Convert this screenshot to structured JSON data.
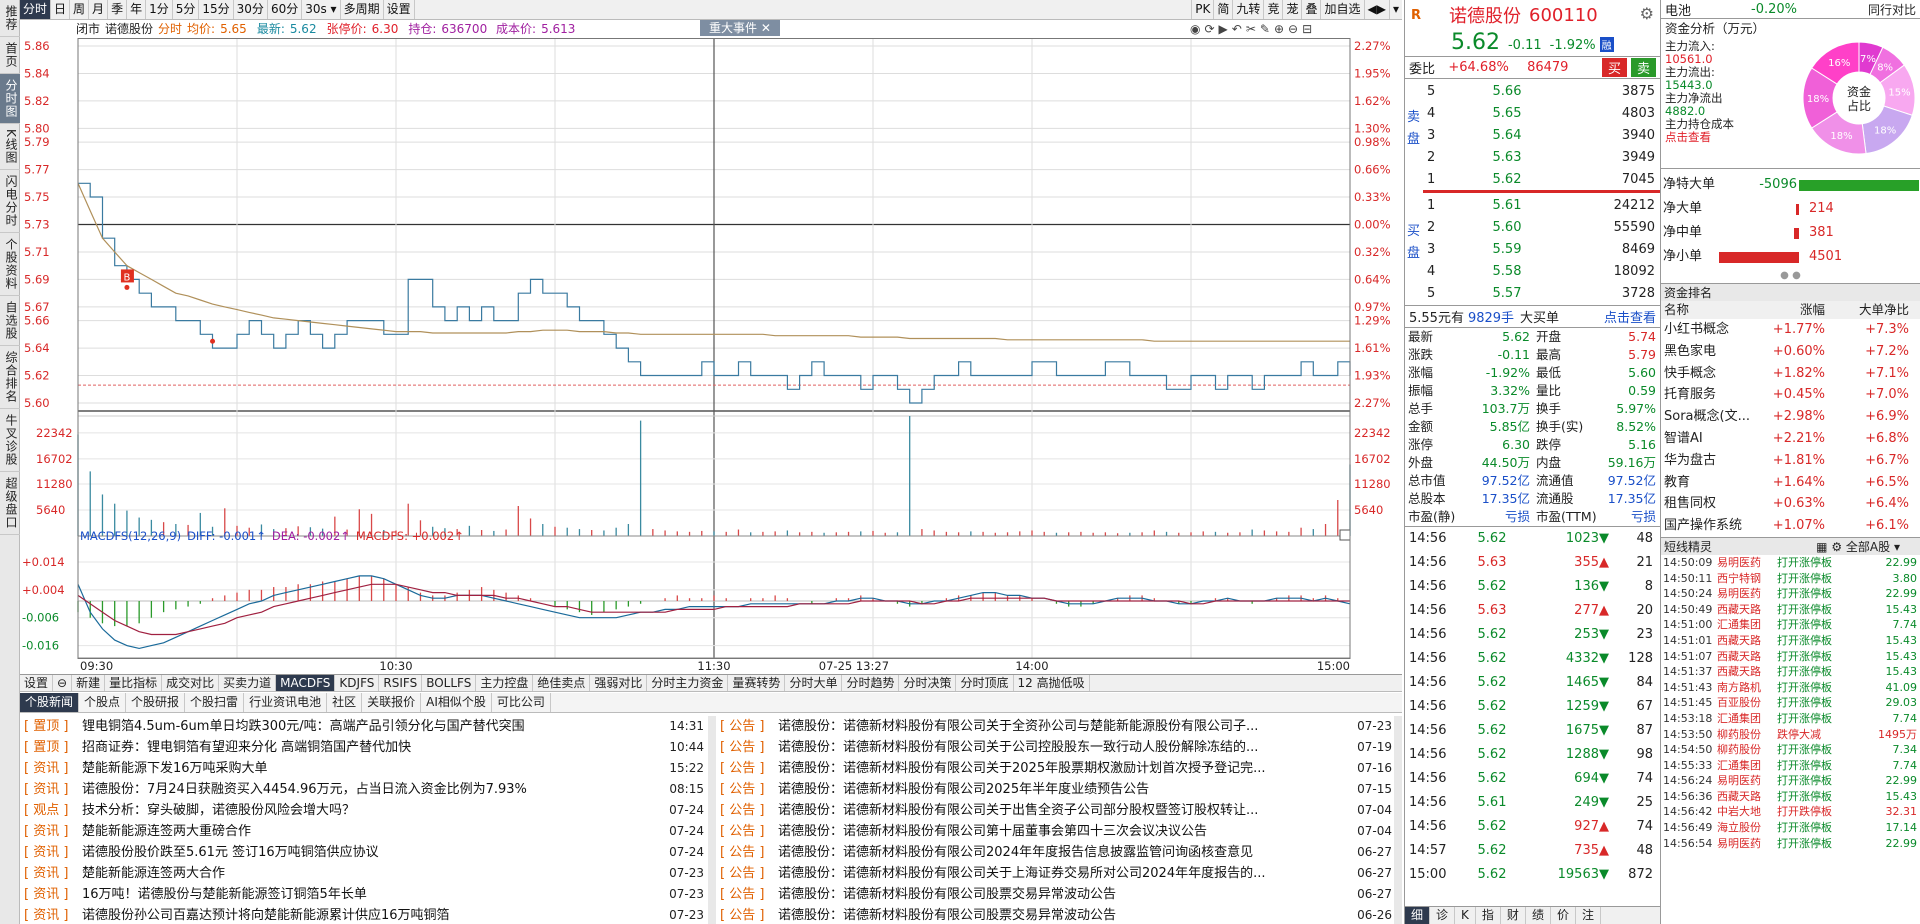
{
  "sidebar": [
    "推荐",
    "首页",
    "分时图",
    "K线图",
    "闪电分时",
    "个股资料",
    "自选股",
    "综合排名",
    "牛叉诊股",
    "超级盘口"
  ],
  "toolbar": {
    "left": [
      "分时",
      "日",
      "周",
      "月",
      "季",
      "年",
      "1分",
      "5分",
      "15分",
      "30分",
      "60分",
      "30s ▾",
      "多周期",
      "设置"
    ],
    "right": [
      "PK",
      "简",
      "九转",
      "竞",
      "茏",
      "叠",
      "加自选",
      "◀▶",
      "▾"
    ]
  },
  "head": {
    "market": "闭市",
    "name": "诺德股份",
    "mode": "分时",
    "avg_label": "均价:",
    "avg": "5.65",
    "last_label": "最新:",
    "last": "5.62",
    "limit_label": "张停价:",
    "limit": "6.30",
    "hold_label": "持仓:",
    "hold": "636700",
    "cost_label": "成本价:",
    "cost": "5.613",
    "event": "重大事件"
  },
  "axis": {
    "left": [
      "5.86",
      "5.84",
      "5.82",
      "5.80",
      "5.79",
      "5.77",
      "5.75",
      "5.73",
      "5.71",
      "5.69",
      "5.67",
      "5.66",
      "5.64",
      "5.62",
      "5.60"
    ],
    "right": [
      "2.27%",
      "1.95%",
      "1.62%",
      "1.30%",
      "0.98%",
      "0.66%",
      "0.33%",
      "0.00%",
      "0.32%",
      "0.64%",
      "0.97%",
      "1.29%",
      "1.61%",
      "1.93%",
      "2.27%"
    ],
    "vol": [
      "22342",
      "16702",
      "11280",
      "5640"
    ],
    "macd": [
      "+0.014",
      "+0.004",
      "-0.006",
      "-0.016"
    ],
    "time": [
      "09:30",
      "10:30",
      "11:30",
      "07-25 13:27",
      "14:00",
      "15:00"
    ]
  },
  "macd_head": {
    "name": "MACDFS(12,26,9)",
    "diff": "DIFF: -0.001↑",
    "dea": "DEA: -0.002↑",
    "macd": "MACDFS: +0.002↑"
  },
  "markers": {
    "b": "B"
  },
  "indicator_tabs": [
    "设置",
    "⊖",
    "新建",
    "量比指标",
    "成交对比",
    "买卖力道",
    "MACDFS",
    "KDJFS",
    "RSIFS",
    "BOLLFS",
    "主力控盘",
    "绝佳卖点",
    "强弱对比",
    "分时主力资金",
    "量赛转势",
    "分时大单",
    "分时趋势",
    "分时决策",
    "分时顶底",
    "12 高抛低吸"
  ],
  "news_tabs": [
    "个股新闻",
    "个股点",
    "个股研报",
    "个股扫雷",
    "行业资讯电池",
    "社区",
    "关联报价",
    "AI相似个股",
    "可比公司"
  ],
  "news_left": [
    {
      "cat": "[ 置顶 ]",
      "title": "锂电铜箔4.5um-6um单日均跌300元/吨：高端产品引领分化与国产替代突围",
      "date": "14:31"
    },
    {
      "cat": "[ 置顶 ]",
      "title": "招商证券：锂电铜箔有望迎来分化 高端铜箔国产替代加快",
      "date": "10:44"
    },
    {
      "cat": "[ 资讯 ]",
      "title": "楚能新能源下发16万吨采购大单",
      "date": "15:22"
    },
    {
      "cat": "[ 资讯 ]",
      "title": "诺德股份：7月24日获融资买入4454.96万元，占当日流入资金比例为7.93%",
      "date": "08:15"
    },
    {
      "cat": "[ 观点 ]",
      "title": "技术分析：穿头破脚，诺德股份风险会增大吗？",
      "date": "07-24"
    },
    {
      "cat": "[ 资讯 ]",
      "title": "楚能新能源连签两大重磅合作",
      "date": "07-24"
    },
    {
      "cat": "[ 资讯 ]",
      "title": "诺德股份股价跌至5.61元 签订16万吨铜箔供应协议",
      "date": "07-24"
    },
    {
      "cat": "[ 资讯 ]",
      "title": "楚能新能源连签两大合作",
      "date": "07-23"
    },
    {
      "cat": "[ 资讯 ]",
      "title": "16万吨！诺德股份与楚能新能源签订铜箔5年长单",
      "date": "07-23"
    },
    {
      "cat": "[ 资讯 ]",
      "title": "诺德股份孙公司百嘉达预计将向楚能新能源累计供应16万吨铜箔",
      "date": "07-23"
    }
  ],
  "news_right": [
    {
      "cat": "[ 公告 ]",
      "title": "诺德股份：诺德新材料股份有限公司关于全资孙公司与楚能新能源股份有限公司子...",
      "date": "07-23"
    },
    {
      "cat": "[ 公告 ]",
      "title": "诺德股份：诺德新材料股份有限公司关于公司控股股东一致行动人股份解除冻结的...",
      "date": "07-19"
    },
    {
      "cat": "[ 公告 ]",
      "title": "诺德股份：诺德新材料股份有限公司关于2025年股票期权激励计划首次授予登记完...",
      "date": "07-16"
    },
    {
      "cat": "[ 公告 ]",
      "title": "诺德股份：诺德新材料股份有限公司2025年半年度业绩预告公告",
      "date": "07-15"
    },
    {
      "cat": "[ 公告 ]",
      "title": "诺德股份：诺德新材料股份有限公司关于出售全资子公司部分股权暨签订股权转让...",
      "date": "07-04"
    },
    {
      "cat": "[ 公告 ]",
      "title": "诺德股份：诺德新材料股份有限公司第十届董事会第四十三次会议决议公告",
      "date": "07-04"
    },
    {
      "cat": "[ 公告 ]",
      "title": "诺德股份：诺德新材料股份有限公司2024年年度报告信息披露监管问询函核查意见",
      "date": "06-27"
    },
    {
      "cat": "[ 公告 ]",
      "title": "诺德股份：诺德新材料股份有限公司关于上海证券交易所对公司2024年年度报告的...",
      "date": "06-27"
    },
    {
      "cat": "[ 公告 ]",
      "title": "诺德股份：诺德新材料股份有限公司股票交易异常波动公告",
      "date": "06-27"
    },
    {
      "cat": "[ 公告 ]",
      "title": "诺德股份：诺德新材料股份有限公司股票交易异常波动公告",
      "date": "06-26"
    }
  ],
  "quote": {
    "logo": "R",
    "name": "诺德股份",
    "code": "600110",
    "price": "5.62",
    "change": "-0.11",
    "pct": "-1.92%",
    "tag": "融",
    "wb_label": "委比",
    "wb": "+64.68%",
    "wc": "86479",
    "buy": "买",
    "sell": "卖",
    "asks": [
      {
        "n": "5",
        "p": "5.66",
        "v": "3875"
      },
      {
        "n": "4",
        "p": "5.65",
        "v": "4803"
      },
      {
        "n": "3",
        "p": "5.64",
        "v": "3940"
      },
      {
        "n": "2",
        "p": "5.63",
        "v": "3949"
      },
      {
        "n": "1",
        "p": "5.62",
        "v": "7045"
      }
    ],
    "bids": [
      {
        "n": "1",
        "p": "5.61",
        "v": "24212"
      },
      {
        "n": "2",
        "p": "5.60",
        "v": "55590"
      },
      {
        "n": "3",
        "p": "5.59",
        "v": "8469"
      },
      {
        "n": "4",
        "p": "5.58",
        "v": "18092"
      },
      {
        "n": "5",
        "p": "5.57",
        "v": "3728"
      }
    ],
    "ask_label": "卖盘",
    "bid_label": "买盘",
    "big": {
      "price": "5.55元有",
      "qty": "9829手",
      "label": "大买单",
      "link": "点击查看"
    },
    "stats": [
      [
        "最新",
        "5.62",
        "开盘",
        "5.74"
      ],
      [
        "涨跌",
        "-0.11",
        "最高",
        "5.79"
      ],
      [
        "涨幅",
        "-1.92%",
        "最低",
        "5.60"
      ],
      [
        "振幅",
        "3.32%",
        "量比",
        "0.59"
      ],
      [
        "总手",
        "103.7万",
        "换手",
        "5.97%"
      ],
      [
        "金额",
        "5.85亿",
        "换手(实)",
        "8.52%"
      ],
      [
        "涨停",
        "6.30",
        "跌停",
        "5.16"
      ],
      [
        "外盘",
        "44.50万",
        "内盘",
        "59.16万"
      ],
      [
        "总市值",
        "97.52亿",
        "流通值",
        "97.52亿"
      ],
      [
        "总股本",
        "17.35亿",
        "流通股",
        "17.35亿"
      ],
      [
        "市盈(静)",
        "亏损",
        "市盈(TTM)",
        "亏损"
      ]
    ],
    "trades": [
      [
        "14:56",
        "5.62",
        "1023",
        "48",
        "d"
      ],
      [
        "14:56",
        "5.63",
        "355",
        "21",
        "u"
      ],
      [
        "14:56",
        "5.62",
        "136",
        "8",
        "d"
      ],
      [
        "14:56",
        "5.63",
        "277",
        "20",
        "u"
      ],
      [
        "14:56",
        "5.62",
        "253",
        "23",
        "d"
      ],
      [
        "14:56",
        "5.62",
        "4332",
        "128",
        "d"
      ],
      [
        "14:56",
        "5.62",
        "1465",
        "84",
        "d"
      ],
      [
        "14:56",
        "5.62",
        "1259",
        "67",
        "d"
      ],
      [
        "14:56",
        "5.62",
        "1675",
        "87",
        "d"
      ],
      [
        "14:56",
        "5.62",
        "1288",
        "98",
        "d"
      ],
      [
        "14:56",
        "5.62",
        "694",
        "74",
        "d"
      ],
      [
        "14:56",
        "5.61",
        "249",
        "25",
        "d"
      ],
      [
        "14:56",
        "5.62",
        "927",
        "74",
        "u"
      ],
      [
        "14:57",
        "5.62",
        "735",
        "48",
        "u"
      ],
      [
        "15:00",
        "5.62",
        "19563",
        "872",
        "d"
      ]
    ],
    "bottom_tabs": [
      "细",
      "诊",
      "K",
      "指",
      "财",
      "绩",
      "价",
      "注"
    ]
  },
  "fund": {
    "top_name": "电池",
    "top_pct": "-0.20%",
    "top_right": "同行对比",
    "title": "资金分析（万元）",
    "inflow_label": "主力流入:",
    "inflow": "10561.0",
    "outflow_label": "主力流出:",
    "outflow": "15443.0",
    "net_label": "主力净流出",
    "net": "4882.0",
    "cost_label": "主力持仓成本",
    "cost_link": "点击查看",
    "donut_center": "资金占比",
    "donut": [
      {
        "label": "7%",
        "v": 7,
        "c": "#e03ad0"
      },
      {
        "label": "8%",
        "v": 8,
        "c": "#f070e0"
      },
      {
        "label": "15%",
        "v": 15,
        "c": "#f8a8f0"
      },
      {
        "label": "18%",
        "v": 18,
        "c": "#c8a8f0"
      },
      {
        "label": "18%",
        "v": 18,
        "c": "#f090e8"
      },
      {
        "label": "18%",
        "v": 18,
        "c": "#f060d8"
      },
      {
        "label": "16%",
        "v": 16,
        "c": "#ff40c8"
      }
    ],
    "flows": [
      {
        "label": "净特大单",
        "value": "-5096",
        "w": 170,
        "c": "#28a028"
      },
      {
        "label": "净大单",
        "value": "214",
        "w": 3,
        "c": "#d82828"
      },
      {
        "label": "净中单",
        "value": "381",
        "w": 5,
        "c": "#d82828"
      },
      {
        "label": "净小单",
        "value": "4501",
        "w": 80,
        "c": "#d82828"
      }
    ],
    "rank_title": "资金排名",
    "rank_cols": [
      "名称",
      "涨幅",
      "大单净比"
    ],
    "rank": [
      [
        "小红书概念",
        "+1.77%",
        "+7.3%"
      ],
      [
        "黑色家电",
        "+0.60%",
        "+7.2%"
      ],
      [
        "快手概念",
        "+1.82%",
        "+7.1%"
      ],
      [
        "托育服务",
        "+0.45%",
        "+7.0%"
      ],
      [
        "Sora概念(文...",
        "+2.98%",
        "+6.9%"
      ],
      [
        "智谱AI",
        "+2.21%",
        "+6.8%"
      ],
      [
        "华为盘古",
        "+1.81%",
        "+6.7%"
      ],
      [
        "教育",
        "+1.64%",
        "+6.5%"
      ],
      [
        "租售同权",
        "+0.63%",
        "+6.4%"
      ],
      [
        "国产操作系统",
        "+1.07%",
        "+6.1%"
      ]
    ],
    "spirit_title": "短线精灵",
    "spirit_filter": "全部A股",
    "spirit": [
      [
        "14:50:09",
        "易明医药",
        "打开涨停板",
        "22.99"
      ],
      [
        "14:50:11",
        "西宁特钢",
        "打开涨停板",
        "3.80"
      ],
      [
        "14:50:24",
        "易明医药",
        "打开涨停板",
        "22.99"
      ],
      [
        "14:50:49",
        "西藏天路",
        "打开涨停板",
        "15.43"
      ],
      [
        "14:51:00",
        "汇通集团",
        "打开涨停板",
        "7.74"
      ],
      [
        "14:51:01",
        "西藏天路",
        "打开涨停板",
        "15.43"
      ],
      [
        "14:51:07",
        "西藏天路",
        "打开涨停板",
        "15.43"
      ],
      [
        "14:51:37",
        "西藏天路",
        "打开涨停板",
        "15.43"
      ],
      [
        "14:51:43",
        "南方路机",
        "打开涨停板",
        "41.09"
      ],
      [
        "14:51:45",
        "百亚股份",
        "打开涨停板",
        "29.03"
      ],
      [
        "14:53:18",
        "汇通集团",
        "打开涨停板",
        "7.74"
      ],
      [
        "14:53:50",
        "柳药股份",
        "跌停大减",
        "1495万"
      ],
      [
        "14:54:50",
        "柳药股份",
        "打开涨停板",
        "7.34"
      ],
      [
        "14:55:33",
        "汇通集团",
        "打开涨停板",
        "7.74"
      ],
      [
        "14:56:24",
        "易明医药",
        "打开涨停板",
        "22.99"
      ],
      [
        "14:56:36",
        "西藏天路",
        "打开涨停板",
        "15.43"
      ],
      [
        "14:56:42",
        "中岩大地",
        "打开跌停板",
        "32.31"
      ],
      [
        "14:56:49",
        "海立股份",
        "打开涨停板",
        "17.14"
      ],
      [
        "14:56:54",
        "易明医药",
        "打开涨停板",
        "22.99"
      ]
    ]
  },
  "chart_data": {
    "type": "line",
    "ylim": [
      5.6,
      5.86
    ],
    "price": [
      5.76,
      5.75,
      5.72,
      5.7,
      5.69,
      5.68,
      5.67,
      5.67,
      5.66,
      5.66,
      5.65,
      5.64,
      5.64,
      5.65,
      5.66,
      5.65,
      5.64,
      5.65,
      5.66,
      5.65,
      5.64,
      5.65,
      5.66,
      5.66,
      5.66,
      5.65,
      5.65,
      5.69,
      5.69,
      5.67,
      5.66,
      5.67,
      5.66,
      5.67,
      5.66,
      5.66,
      5.68,
      5.69,
      5.68,
      5.68,
      5.67,
      5.66,
      5.66,
      5.65,
      5.64,
      5.63,
      5.62,
      5.62,
      5.62,
      5.62,
      5.62,
      5.63,
      5.62,
      5.62,
      5.63,
      5.62,
      5.62,
      5.62,
      5.61,
      5.62,
      5.63,
      5.62,
      5.62,
      5.62,
      5.61,
      5.62,
      5.62,
      5.61,
      5.6,
      5.61,
      5.62,
      5.62,
      5.63,
      5.62,
      5.62,
      5.62,
      5.62,
      5.62,
      5.63,
      5.63,
      5.62,
      5.62,
      5.62,
      5.62,
      5.63,
      5.63,
      5.62,
      5.62,
      5.62,
      5.61,
      5.61,
      5.62,
      5.62,
      5.61,
      5.62,
      5.62,
      5.61,
      5.62,
      5.62,
      5.62,
      5.63,
      5.62,
      5.62,
      5.63,
      5.62
    ],
    "avg": [
      5.76,
      5.74,
      5.72,
      5.71,
      5.7,
      5.695,
      5.69,
      5.685,
      5.68,
      5.678,
      5.675,
      5.672,
      5.67,
      5.668,
      5.666,
      5.664,
      5.662,
      5.661,
      5.66,
      5.659,
      5.658,
      5.657,
      5.656,
      5.655,
      5.654,
      5.653,
      5.652,
      5.652,
      5.652,
      5.651,
      5.651,
      5.651,
      5.651,
      5.651,
      5.651,
      5.651,
      5.652,
      5.652,
      5.653,
      5.653,
      5.653,
      5.652,
      5.652,
      5.652,
      5.651,
      5.651,
      5.65,
      5.65,
      5.65,
      5.65,
      5.65,
      5.65,
      5.65,
      5.65,
      5.65,
      5.65,
      5.65,
      5.649,
      5.649,
      5.649,
      5.649,
      5.649,
      5.649,
      5.649,
      5.648,
      5.648,
      5.648,
      5.648,
      5.647,
      5.647,
      5.647,
      5.647,
      5.647,
      5.647,
      5.647,
      5.647,
      5.646,
      5.646,
      5.646,
      5.646,
      5.646,
      5.646,
      5.646,
      5.646,
      5.646,
      5.646,
      5.646,
      5.646,
      5.645,
      5.645,
      5.645,
      5.645,
      5.645,
      5.645,
      5.645,
      5.645,
      5.645,
      5.645,
      5.645,
      5.645,
      5.645,
      5.645,
      5.645,
      5.645,
      5.645
    ],
    "volume": [
      22000,
      14000,
      9000,
      7000,
      5500,
      4000,
      3500,
      3000,
      2600,
      2400,
      5000,
      2000,
      6000,
      2200,
      1800,
      2500,
      1500,
      1700,
      2100,
      1900,
      1600,
      4200,
      1400,
      5800,
      4800,
      1300,
      1200,
      7000,
      3400,
      2000,
      1700,
      1500,
      2200,
      1300,
      1100,
      1400,
      6500,
      3800,
      2600,
      2000,
      1800,
      1500,
      1300,
      1200,
      1800,
      2600,
      25000,
      1500,
      1200,
      1000,
      900,
      1100,
      1000,
      900,
      1400,
      800,
      900,
      1000,
      1200,
      800,
      900,
      700,
      800,
      900,
      1000,
      1100,
      700,
      800,
      26000,
      1500,
      1200,
      900,
      800,
      1000,
      900,
      700,
      800,
      1000,
      1200,
      900,
      700,
      800,
      900,
      700,
      800,
      600,
      700,
      800,
      1200,
      900,
      700,
      800,
      1000,
      900,
      700,
      800,
      1400,
      1200,
      1000,
      900,
      1800,
      1500,
      2600,
      7800,
      15500
    ],
    "macd": [
      -0.004,
      -0.006,
      -0.008,
      -0.009,
      -0.009,
      -0.008,
      -0.006,
      -0.004,
      -0.003,
      -0.002,
      -0.001,
      0.001,
      0.002,
      0.003,
      0.004,
      0.004,
      0.005,
      0.005,
      0.006,
      0.006,
      0.007,
      0.007,
      0.008,
      0.009,
      0.009,
      0.008,
      0.006,
      0.005,
      0.003,
      0.002,
      0.002,
      0.003,
      0.004,
      0.005,
      0.004,
      0.003,
      0.002,
      0.001,
      0.0,
      -0.002,
      -0.003,
      -0.004,
      -0.005,
      -0.004,
      -0.003,
      -0.002,
      -0.001,
      0.0,
      0.001,
      0.002,
      0.001,
      0.001,
      0.002,
      0.001,
      0.0,
      0.001,
      0.001,
      0.002,
      0.001,
      0.0,
      -0.001,
      0.0,
      0.001,
      0.001,
      0.002,
      0.001,
      0.0,
      -0.001,
      -0.002,
      -0.001,
      0.0,
      0.001,
      0.002,
      0.002,
      0.003,
      0.003,
      0.002,
      0.002,
      0.001,
      0.0,
      -0.001,
      -0.002,
      -0.002,
      -0.001,
      0.0,
      0.001,
      0.002,
      0.002,
      0.001,
      0.0,
      -0.001,
      -0.001,
      0.0,
      0.001,
      0.001,
      0.0,
      -0.001,
      0.0,
      0.001,
      0.002,
      0.002,
      0.001,
      0.002,
      0.001,
      0.0
    ],
    "diff": [
      0.006,
      -0.004,
      -0.01,
      -0.014,
      -0.016,
      -0.017,
      -0.016,
      -0.015,
      -0.013,
      -0.011,
      -0.009,
      -0.007,
      -0.005,
      -0.003,
      -0.001,
      0.0,
      0.002,
      0.003,
      0.004,
      0.005,
      0.006,
      0.007,
      0.008,
      0.009,
      0.009,
      0.008,
      0.006,
      0.004,
      0.002,
      0.001,
      0.001,
      0.002,
      0.002,
      0.002,
      0.001,
      0.0,
      -0.001,
      -0.002,
      -0.003,
      -0.004,
      -0.005,
      -0.006,
      -0.006,
      -0.006,
      -0.006,
      -0.005,
      -0.004,
      -0.004,
      -0.003,
      -0.003,
      -0.002,
      -0.002,
      -0.002,
      -0.002,
      -0.002,
      -0.001,
      -0.001,
      -0.001,
      -0.001,
      -0.001,
      -0.001,
      -0.001,
      0.0,
      0.0,
      0.001,
      0.001,
      0.0,
      0.0,
      -0.001,
      -0.001,
      0.0,
      0.0,
      0.001,
      0.002,
      0.003,
      0.003,
      0.002,
      0.002,
      0.001,
      0.001,
      0.0,
      -0.001,
      -0.001,
      -0.001,
      0.0,
      0.001,
      0.001,
      0.001,
      0.0,
      0.0,
      -0.001,
      -0.001,
      0.0,
      0.0,
      0.001,
      0.0,
      0.0,
      0.0,
      0.001,
      0.001,
      0.001,
      0.0,
      0.001,
      0.0,
      -0.001
    ],
    "dea": [
      0.002,
      -0.001,
      -0.004,
      -0.007,
      -0.009,
      -0.011,
      -0.012,
      -0.012,
      -0.012,
      -0.011,
      -0.01,
      -0.009,
      -0.008,
      -0.006,
      -0.005,
      -0.004,
      -0.002,
      -0.001,
      0.0,
      0.001,
      0.002,
      0.003,
      0.004,
      0.005,
      0.006,
      0.006,
      0.006,
      0.005,
      0.004,
      0.003,
      0.003,
      0.002,
      0.002,
      0.002,
      0.002,
      0.001,
      0.001,
      0.0,
      -0.001,
      -0.002,
      -0.002,
      -0.003,
      -0.004,
      -0.004,
      -0.004,
      -0.004,
      -0.004,
      -0.004,
      -0.004,
      -0.003,
      -0.003,
      -0.003,
      -0.003,
      -0.002,
      -0.002,
      -0.002,
      -0.002,
      -0.002,
      -0.002,
      -0.001,
      -0.001,
      -0.001,
      -0.001,
      -0.001,
      0.0,
      0.0,
      0.0,
      0.0,
      0.0,
      -0.001,
      -0.001,
      0.0,
      0.0,
      0.001,
      0.001,
      0.001,
      0.001,
      0.001,
      0.001,
      0.001,
      0.0,
      0.0,
      0.0,
      0.0,
      0.0,
      0.0,
      0.0,
      0.0,
      0.0,
      0.0,
      0.0,
      -0.001,
      -0.001,
      0.0,
      0.0,
      0.0,
      0.0,
      0.0,
      0.0,
      0.0,
      0.0,
      0.0,
      0.0,
      0.0,
      0.0
    ]
  }
}
